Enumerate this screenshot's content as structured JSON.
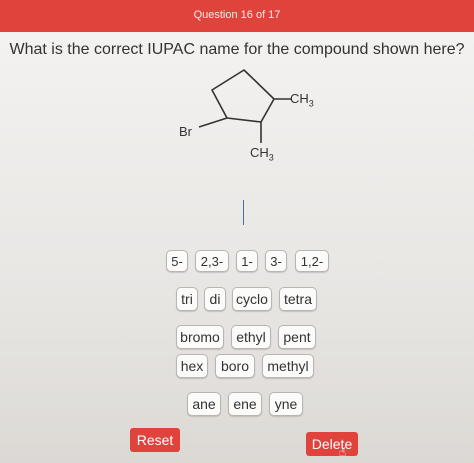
{
  "header": {
    "title": "Question 16 of 17"
  },
  "question": {
    "text": "What is the correct IUPAC name for the compound shown here?"
  },
  "structure": {
    "substituent_br": "Br",
    "substituent_ch3_top": "CH",
    "substituent_ch3_top_sub": "3",
    "substituent_ch3_bottom": "CH",
    "substituent_ch3_bottom_sub": "3"
  },
  "tiles": {
    "row1": [
      "5-",
      "2,3-",
      "1-",
      "3-",
      "1,2-"
    ],
    "row2": [
      "tri",
      "di",
      "cyclo",
      "tetra"
    ],
    "row3": [
      "bromo",
      "ethyl",
      "pent"
    ],
    "row4": [
      "hex",
      "boro",
      "methyl"
    ],
    "row5": [
      "ane",
      "ene",
      "yne"
    ]
  },
  "buttons": {
    "reset": "Reset",
    "delete": "Delete"
  },
  "colors": {
    "accent": "#e0433c"
  },
  "icons": {
    "cursor": "hand-pointer-icon"
  }
}
